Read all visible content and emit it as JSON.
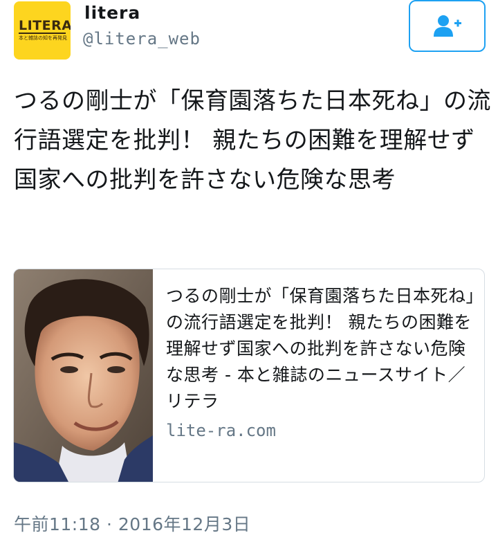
{
  "author": {
    "display_name": "litera",
    "screen_name": "@litera_web",
    "avatar": {
      "logo_text": "LITERA",
      "tagline": "本と雑誌の知を再発見"
    }
  },
  "follow_button": {
    "icon": "follow-user-plus-icon",
    "accent": "#1da1f2"
  },
  "tweet": {
    "text": "つるの剛士が「保育園落ちた日本死ね」の流行語選定を批判！ 親たちの困難を理解せず国家への批判を許さない危険な思考"
  },
  "card": {
    "title": "つるの剛士が「保育園落ちた日本死ね」の流行語選定を批判！ 親たちの困難を理解せず国家への批判を許さない危険な思考 - 本と雑誌のニュースサイト／リテラ",
    "domain": "lite-ra.com"
  },
  "timestamp": "午前11:18 · 2016年12月3日"
}
